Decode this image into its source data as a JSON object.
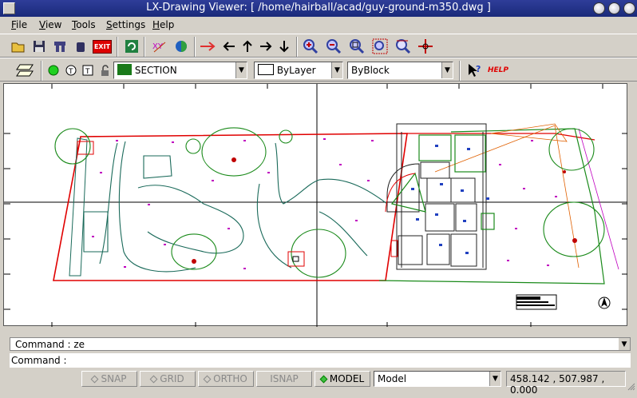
{
  "window": {
    "title": "LX-Drawing Viewer: [ /home/hairball/acad/guy-ground-m350.dwg ]"
  },
  "menu": [
    {
      "label_u": "F",
      "label_rest": "ile"
    },
    {
      "label_u": "V",
      "label_rest": "iew"
    },
    {
      "label_u": "T",
      "label_rest": "ools"
    },
    {
      "label_u": "S",
      "label_rest": "ettings"
    },
    {
      "label_u": "H",
      "label_rest": "elp"
    }
  ],
  "toolbar": {
    "exit_label": "EXIT",
    "help_label": "HELP"
  },
  "layer_bar": {
    "layer_name": "SECTION",
    "layer_color": "#1a7a1a",
    "linetype": "ByLayer",
    "lineweight": "ByBlock"
  },
  "command": {
    "history": "Command : ze",
    "prompt": "Command :"
  },
  "status": {
    "snap": "SNAP",
    "grid": "GRID",
    "ortho": "ORTHO",
    "isnap": "ISNAP",
    "model": "MODEL",
    "space": "Model",
    "coords": "458.142 , 507.987 , 0.000"
  },
  "colors": {
    "boundary": "#e00000",
    "trees": "#1a8a1a",
    "paths": "#1a6a5a",
    "house": "#202020",
    "accent_blue": "#2040c0",
    "accent_magenta": "#c000c0",
    "orange": "#e06000"
  }
}
